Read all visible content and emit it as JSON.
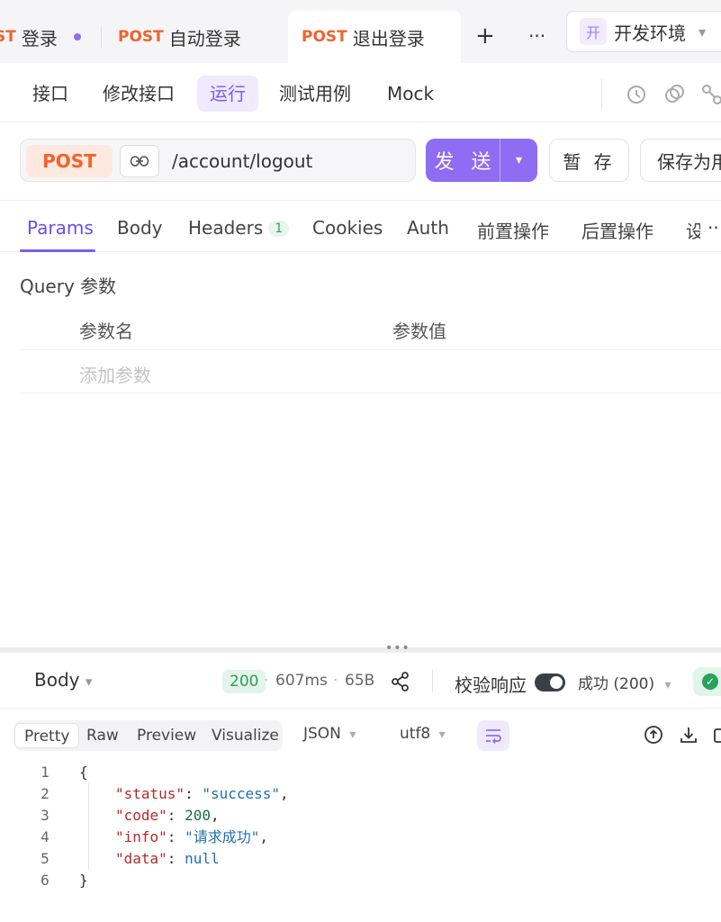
{
  "top_tabs": [
    {
      "method": "ST",
      "name": "登录",
      "unsaved": true
    },
    {
      "method": "POST",
      "name": "自动登录"
    },
    {
      "method": "POST",
      "name": "退出登录",
      "active": true
    }
  ],
  "top_actions": {
    "new_tab": "+",
    "more": "···"
  },
  "environment": {
    "badge": "开",
    "name": "开发环境"
  },
  "subnav": {
    "items": [
      "接口",
      "修改接口",
      "运行",
      "测试用例",
      "Mock"
    ],
    "active": "运行"
  },
  "request": {
    "method": "POST",
    "url": "/account/logout",
    "send_label": "发 送",
    "save_label": "暂 存",
    "save_as_label": "保存为用"
  },
  "param_tabs": {
    "items": [
      "Params",
      "Body",
      "Headers",
      "Cookies",
      "Auth",
      "前置操作",
      "后置操作",
      "设"
    ],
    "headers_count": "1",
    "active": "Params",
    "more": "··"
  },
  "query": {
    "label": "Query 参数",
    "col_name": "参数名",
    "col_value": "参数值",
    "add_placeholder": "添加参数"
  },
  "response": {
    "body_label": "Body",
    "status": "200",
    "time": "607ms",
    "size": "65B",
    "validate_label": "校验响应",
    "result_label": "成功 (200)",
    "view_tabs": [
      "Pretty",
      "Raw",
      "Preview",
      "Visualize"
    ],
    "active_view": "Pretty",
    "format": "JSON",
    "encoding": "utf8",
    "separator": "·"
  },
  "code_lines": [
    {
      "n": "1",
      "text": "{"
    },
    {
      "n": "2",
      "key": "\"status\"",
      "value": "\"success\"",
      "vtype": "s",
      "comma": ","
    },
    {
      "n": "3",
      "key": "\"code\"",
      "value": "200",
      "vtype": "n",
      "comma": ","
    },
    {
      "n": "4",
      "key": "\"info\"",
      "value": "\"请求成功\"",
      "vtype": "s",
      "comma": ","
    },
    {
      "n": "5",
      "key": "\"data\"",
      "value": "null",
      "vtype": "s",
      "comma": ""
    },
    {
      "n": "6",
      "text": "}"
    }
  ],
  "colors": {
    "accent": "#8e6cf3",
    "method": "#f2622b",
    "success": "#2e9e58"
  }
}
